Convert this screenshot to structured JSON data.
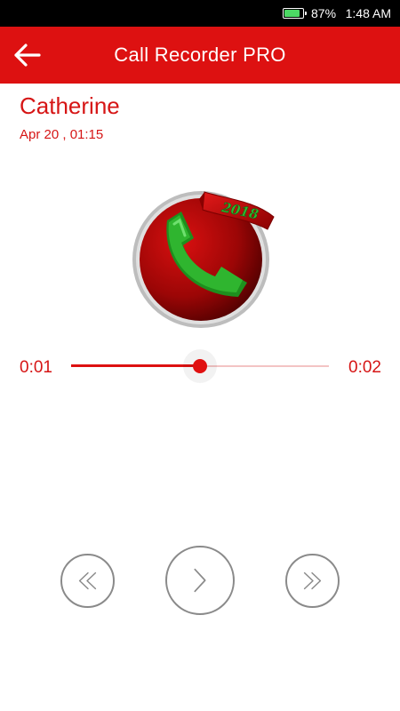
{
  "status_bar": {
    "battery_percent": "87%",
    "time": "1:48 AM",
    "battery_level": 0.87,
    "battery_color": "#4cd964"
  },
  "app_bar": {
    "title": "Call Recorder PRO",
    "back_icon": "arrow-left-icon",
    "background_color": "#dd1111"
  },
  "recording": {
    "contact_name": "Catherine",
    "datetime": "Apr 20 , 01:15",
    "logo_badge_text": "2018"
  },
  "player": {
    "current_time": "0:01",
    "total_time": "0:02",
    "progress": 0.5,
    "accent_color": "#dd1111",
    "controls": [
      {
        "name": "rewind",
        "icon": "double-chevron-left-icon"
      },
      {
        "name": "play",
        "icon": "chevron-right-icon"
      },
      {
        "name": "fast-forward",
        "icon": "double-chevron-right-icon"
      }
    ]
  }
}
